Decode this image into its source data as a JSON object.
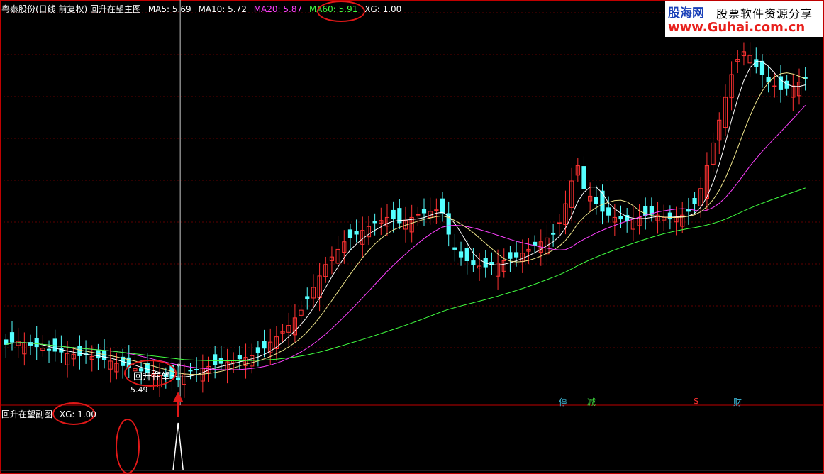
{
  "window": {
    "stock_title": "粤泰股份(日线 前复权) 回升在望主图"
  },
  "main_legend": [
    {
      "label": "MA5: 5.69",
      "color": "#ffffff"
    },
    {
      "label": "MA10: 5.72",
      "color": "#ffffff"
    },
    {
      "label": "MA20: 5.87",
      "color": "#ff40ff"
    },
    {
      "label": "MA60: 5.91",
      "color": "#40ff40"
    },
    {
      "label": "XG: 1.00",
      "color": "#ffffff"
    }
  ],
  "sub_legend": {
    "title": "回升在望副图",
    "xg": "XG: 1.00"
  },
  "watermark": {
    "line1": "股海网",
    "line2": "股票软件资源分享",
    "line3": "www.Guhai.com.cn"
  },
  "annotations": {
    "signal_label": "回升在望",
    "low_price": "5.49"
  },
  "event_markers": [
    {
      "label": "停",
      "color": "#40c0e0"
    },
    {
      "label": "减",
      "color": "#40e040"
    },
    {
      "label": "$",
      "color": "#ff3030"
    },
    {
      "label": "财",
      "color": "#40c0e0"
    }
  ],
  "colors": {
    "up": "#ff3232",
    "down": "#54ffff",
    "ma5": "#ffffff",
    "ma10": "#f0e68c",
    "ma20": "#ff40ff",
    "ma60": "#40ff40",
    "grid": "#600000",
    "divider": "#c00000",
    "highlight": "#e01818"
  },
  "chart_data": {
    "type": "candlestick",
    "sub_indicator": "XG",
    "ma60_end": 5.91,
    "close_series": [
      5.95,
      5.98,
      5.99,
      5.97,
      5.94,
      5.92,
      5.9,
      5.88,
      5.86,
      5.85,
      5.83,
      5.82,
      5.8,
      5.81,
      5.79,
      5.77,
      5.75,
      5.73,
      5.7,
      5.67,
      5.65,
      5.63,
      5.6,
      5.58,
      5.56,
      5.54,
      5.52,
      5.5,
      5.49,
      5.55,
      5.6,
      5.62,
      5.64,
      5.66,
      5.68,
      5.7,
      5.72,
      5.74,
      5.76,
      5.78,
      5.8,
      5.84,
      5.9,
      5.98,
      6.05,
      6.12,
      6.2,
      6.3,
      6.4,
      6.55,
      6.7,
      6.85,
      7.0,
      7.1,
      7.2,
      7.3,
      7.35,
      7.4,
      7.45,
      7.5,
      7.55,
      7.58,
      7.62,
      7.6,
      7.55,
      7.58,
      7.62,
      7.66,
      7.68,
      7.7,
      7.72,
      7.68,
      7.4,
      7.2,
      7.1,
      7.05,
      7.0,
      6.98,
      6.97,
      7.0,
      7.02,
      7.05,
      7.08,
      7.1,
      7.15,
      7.2,
      7.25,
      7.3,
      7.35,
      7.4,
      7.55,
      7.8,
      8.1,
      8.3,
      8.0,
      7.9,
      7.8,
      7.7,
      7.65,
      7.62,
      7.6,
      7.58,
      7.6,
      7.62,
      7.64,
      7.66,
      7.65,
      7.62,
      7.6,
      7.62,
      7.65,
      7.7,
      7.8,
      8.0,
      8.3,
      8.6,
      8.9,
      9.2,
      9.5,
      9.7,
      9.8,
      9.75,
      9.6,
      9.5,
      9.4,
      9.35,
      9.3,
      9.32,
      9.35,
      9.4,
      9.45
    ]
  }
}
